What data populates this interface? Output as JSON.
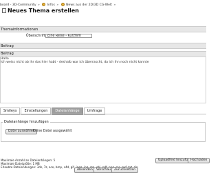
{
  "breadcrumb": {
    "item1": "board - 3D-Community",
    "item2": "Infos",
    "item3": "News aus der 2D/3D CG-Welt",
    "separator": "»"
  },
  "page_title": "Neues Thema erstellen",
  "sections": {
    "topic_info": "Themainformationen",
    "post": "Beitrag",
    "post2": "Beitrag"
  },
  "fields": {
    "subject_label": "Überschrift",
    "subject_value": "Eine Reise - Kurzfilm"
  },
  "body_text": {
    "line1": "Hallo",
    "line2": "Ich weiss nicht ob ihr das hier habt - deshalb war ich überrascht, da ich ihn noch nicht kannte"
  },
  "tabs": [
    {
      "label": "Smileys",
      "active": false
    },
    {
      "label": "Einstellungen",
      "active": false
    },
    {
      "label": "Dateianhänge",
      "active": true
    },
    {
      "label": "Umfrage",
      "active": false
    }
  ],
  "attachments": {
    "legend": "Dateianhänge hinzufügen",
    "choose_button": "Datei auswählen",
    "no_file": "Keine Datei ausgewählt",
    "max_count": "Maximale Anzahl an Dateianhängen: 5",
    "max_size": "Maximale Dateigröße: 1 MB",
    "allowed_ext": "Erlaubte Dateiendungen: 3ds, 7z, ace, bmp, c4d, gif, jpeg, jpg, ma, obj, pdf, png, rar, swf, txt, zip",
    "upload_button": "Hochladen",
    "inline_upload_button": "Uploadfeld hinzufügen"
  },
  "actions": {
    "submit": "Absenden",
    "preview": "Vorschau",
    "reset": "Zurücksetzen"
  }
}
